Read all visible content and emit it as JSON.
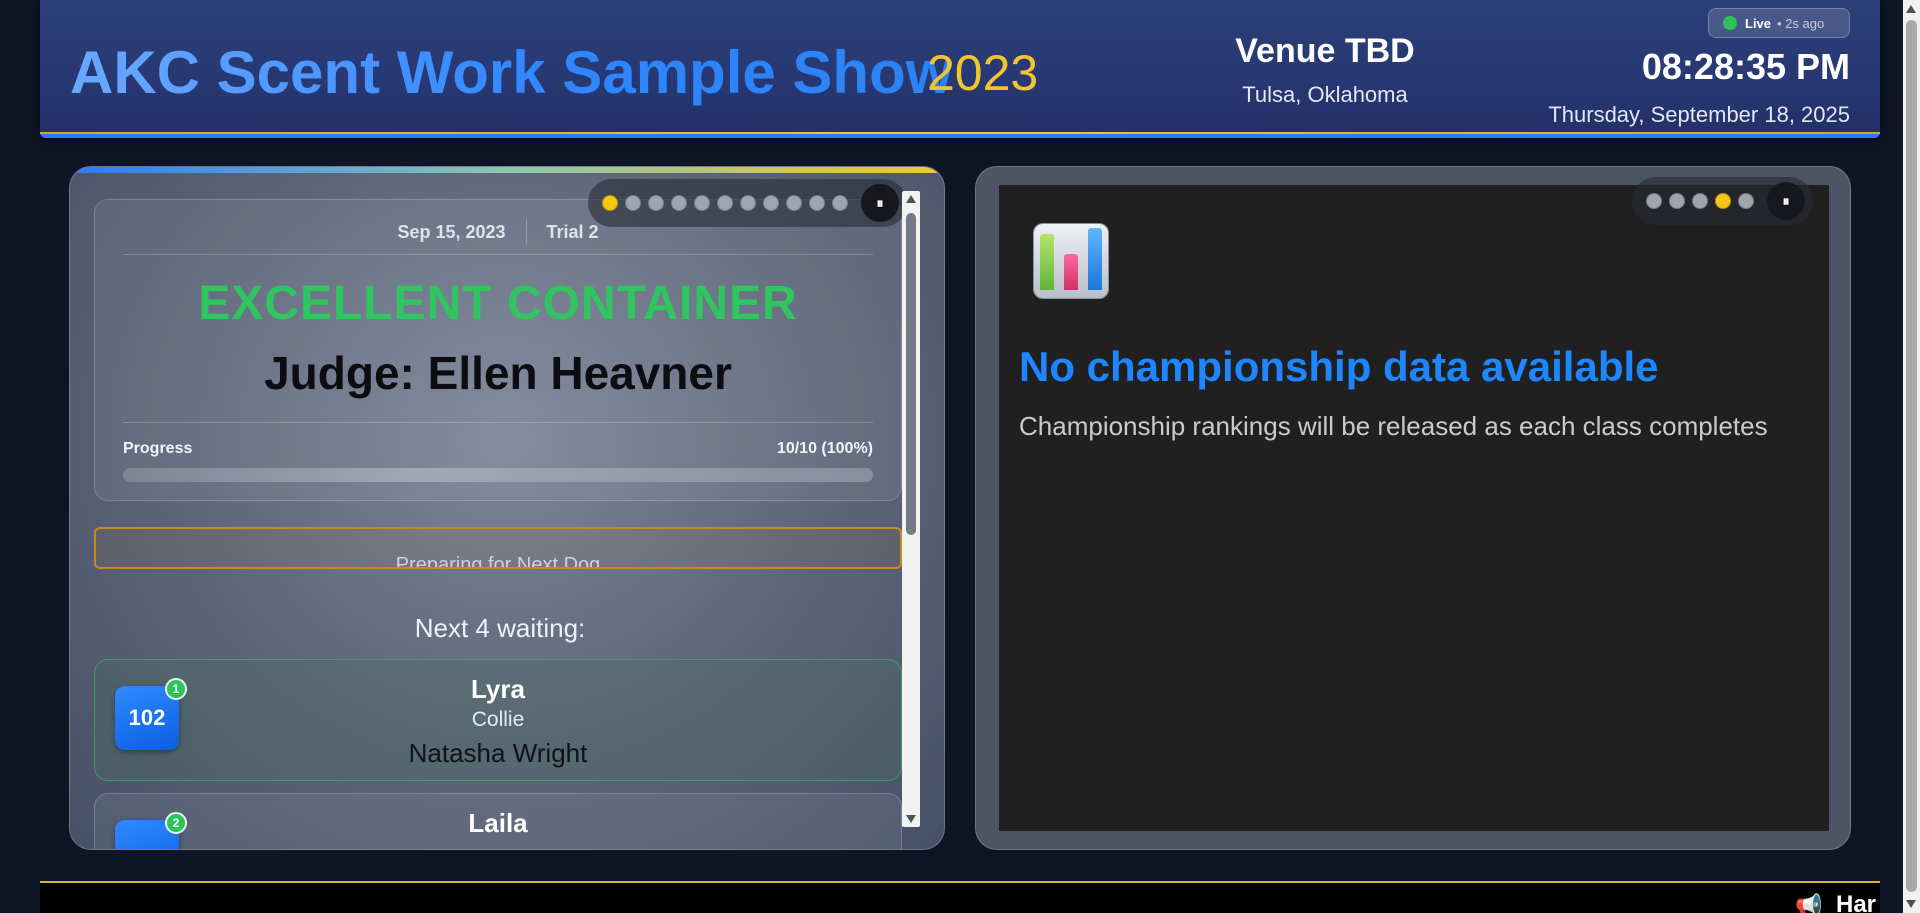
{
  "header": {
    "title": "AKC Scent Work Sample Show",
    "year": "2023",
    "venue_name": "Venue TBD",
    "venue_location": "Tulsa, Oklahoma",
    "live_label": "Live",
    "live_ago": "• 2s ago",
    "clock": "08:28:35 PM",
    "date": "Thursday, September 18, 2025",
    "accent_color": "#2a7bff",
    "gold_color": "#f2c530"
  },
  "left_panel": {
    "carousel": {
      "dot_count": 11,
      "active_index": 0,
      "pause_label": "⏸"
    },
    "class_card": {
      "date": "Sep 15, 2023",
      "trial": "Trial 2",
      "class_name": "EXCELLENT CONTAINER",
      "judge": "Judge: Ellen Heavner",
      "progress_label": "Progress",
      "progress_value": "10/10 (100%)",
      "progress_fraction": 1.0
    },
    "status_banner": "Preparing for Next Dog",
    "waiting_title": "Next 4 waiting:",
    "entries": [
      {
        "armband": "102",
        "rank": "1",
        "dog": "Lyra",
        "breed": "Collie",
        "handler": "Natasha Wright"
      },
      {
        "armband": "",
        "rank": "2",
        "dog": "Laila",
        "breed": "",
        "handler": ""
      }
    ]
  },
  "right_panel": {
    "carousel": {
      "dot_count": 5,
      "active_index": 3,
      "pause_label": "⏸"
    },
    "icon": "bar-chart-icon",
    "title": "No championship data available",
    "subtitle": "Championship rankings will be released as each class completes"
  },
  "footer": {
    "icon": "megaphone-icon",
    "ticker_text": "Har"
  }
}
